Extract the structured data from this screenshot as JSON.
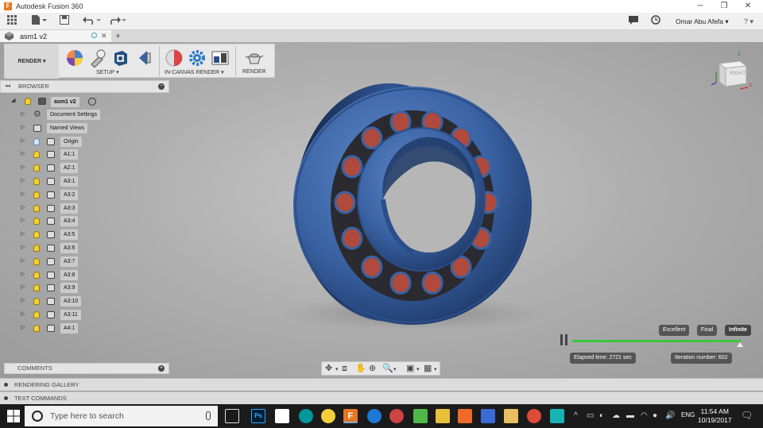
{
  "window": {
    "title": "Autodesk Fusion 360",
    "minimize": "─",
    "maximize": "❐",
    "close": "✕"
  },
  "qat": {
    "user": "Omar Abu Afefa ▾",
    "help": "? ▾"
  },
  "doc_tab": {
    "name": "asm1 v2",
    "close": "✕",
    "new": "+"
  },
  "toolbar": {
    "workspace": "RENDER ▾",
    "groups": [
      {
        "label": "SETUP ▾"
      },
      {
        "label": "IN-CANVAS RENDER ▾"
      },
      {
        "label": "RENDER"
      }
    ]
  },
  "browser": {
    "title": "BROWSER",
    "collapse": "◂◂",
    "minus": "−",
    "root": "asm1 v2",
    "items": [
      {
        "label": "Document Settings",
        "icon": "gear-icon"
      },
      {
        "label": "Named Views",
        "icon": "folder-icon"
      },
      {
        "label": "Origin",
        "icon": "folder-icon"
      },
      {
        "label": "A1:1",
        "icon": "component-icon"
      },
      {
        "label": "A2:1",
        "icon": "component-icon"
      },
      {
        "label": "A3:1",
        "icon": "component-icon"
      },
      {
        "label": "A3:2",
        "icon": "component-icon"
      },
      {
        "label": "A3:3",
        "icon": "component-icon"
      },
      {
        "label": "A3:4",
        "icon": "component-icon"
      },
      {
        "label": "A3:5",
        "icon": "component-icon"
      },
      {
        "label": "A3:6",
        "icon": "component-icon"
      },
      {
        "label": "A3:7",
        "icon": "component-icon"
      },
      {
        "label": "A3:8",
        "icon": "component-icon"
      },
      {
        "label": "A3:9",
        "icon": "component-icon"
      },
      {
        "label": "A3:10",
        "icon": "component-icon"
      },
      {
        "label": "A3:11",
        "icon": "component-icon"
      },
      {
        "label": "A4:1",
        "icon": "component-icon"
      }
    ]
  },
  "viewcube": {
    "face": "RIGHT",
    "axis_z": "Z",
    "axis_x": "X"
  },
  "comments": {
    "title": "COMMENTS",
    "plus": "+"
  },
  "bottom_panels": {
    "gallery": "RENDERING GALLERY",
    "text_commands": "TEXT COMMANDS"
  },
  "render_progress": {
    "quality": [
      "Excellent",
      "Final",
      "Infinite"
    ],
    "selected_quality": "Infinite",
    "elapsed": "Elapsed time: 2721 sec",
    "iteration": "Iteration number: 602"
  },
  "taskbar": {
    "search_placeholder": "Type here to search",
    "language": "ENG",
    "time": "11:54 AM",
    "date": "10/19/2017"
  },
  "colors": {
    "accent": "#0696d7",
    "progress": "#38c838",
    "bearing": "#3a63a4"
  }
}
